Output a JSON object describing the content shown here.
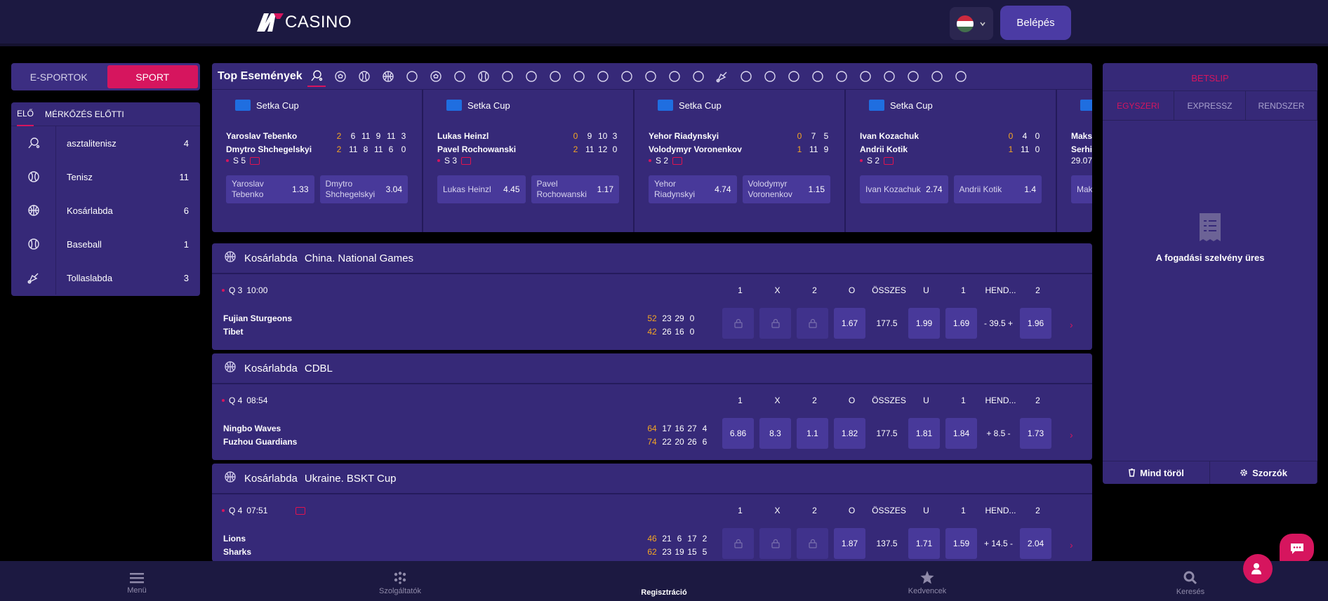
{
  "header": {
    "logo_text": "CASINO",
    "login_label": "Belépés"
  },
  "left": {
    "tabs": [
      "E-SPORTOK",
      "SPORT"
    ],
    "subtabs": [
      "ELŐ",
      "MÉRKŐZÉS ELŐTTI"
    ],
    "sports": [
      {
        "name": "asztalitenisz",
        "count": "4",
        "icon": "table-tennis-icon"
      },
      {
        "name": "Tenisz",
        "count": "11",
        "icon": "tennis-icon"
      },
      {
        "name": "Kosárlabda",
        "count": "6",
        "icon": "basketball-icon"
      },
      {
        "name": "Baseball",
        "count": "1",
        "icon": "baseball-icon"
      },
      {
        "name": "Tollaslabda",
        "count": "3",
        "icon": "badminton-icon"
      }
    ]
  },
  "top_events": {
    "title": "Top Események",
    "cards": [
      {
        "league": "Setka Cup",
        "p1": "Yaroslav Tebenko",
        "p2": "Dmytro Shchegelskyi",
        "s1": "2",
        "s2": "2",
        "sets1": [
          "6",
          "11",
          "9",
          "11",
          "3"
        ],
        "sets2": [
          "11",
          "8",
          "11",
          "6",
          "0"
        ],
        "set": "S 5",
        "o1n": "Yaroslav Tebenko",
        "o1": "1.33",
        "o2n": "Dmytro Shchegelskyi",
        "o2": "3.04"
      },
      {
        "league": "Setka Cup",
        "p1": "Lukas Heinzl",
        "p2": "Pavel Rochowanski",
        "s1": "0",
        "s2": "2",
        "sets1": [
          "9",
          "10",
          "3"
        ],
        "sets2": [
          "11",
          "12",
          "0"
        ],
        "set": "S 3",
        "o1n": "Lukas Heinzl",
        "o1": "4.45",
        "o2n": "Pavel Rochowanski",
        "o2": "1.17"
      },
      {
        "league": "Setka Cup",
        "p1": "Yehor Riadynskyi",
        "p2": "Volodymyr Voronenkov",
        "s1": "0",
        "s2": "1",
        "sets1": [
          "7",
          "5"
        ],
        "sets2": [
          "11",
          "9"
        ],
        "set": "S 2",
        "o1n": "Yehor Riadynskyi",
        "o1": "4.74",
        "o2n": "Volodymyr Voronenkov",
        "o2": "1.15"
      },
      {
        "league": "Setka Cup",
        "p1": "Ivan Kozachuk",
        "p2": "Andrii Kotik",
        "s1": "0",
        "s2": "1",
        "sets1": [
          "4",
          "0"
        ],
        "sets2": [
          "11",
          "0"
        ],
        "set": "S 2",
        "o1n": "Ivan Kozachuk",
        "o1": "2.74",
        "o2n": "Andrii Kotik",
        "o2": "1.4"
      }
    ],
    "partial": {
      "p1": "Maks",
      "p2": "Serhi",
      "date": "29.07",
      "odd": "Mak"
    }
  },
  "columns": [
    "1",
    "X",
    "2",
    "O",
    "ÖSSZES",
    "U",
    "1",
    "HEND...",
    "2"
  ],
  "matches": [
    {
      "sport": "Kosárlabda",
      "league": "China. National Games",
      "period": "Q 3",
      "time": "10:00",
      "tv": false,
      "t1": "Fujian Sturgeons",
      "t2": "Tibet",
      "p1": "52",
      "p2": "42",
      "q1": [
        "23",
        "29",
        "0"
      ],
      "q2": [
        "26",
        "16",
        "0"
      ],
      "odds": [
        "",
        "",
        "",
        "1.67",
        "177.5",
        "1.99",
        "1.69",
        "- 39.5 +",
        "1.96"
      ],
      "locked": true
    },
    {
      "sport": "Kosárlabda",
      "league": "CDBL",
      "period": "Q 4",
      "time": "08:54",
      "tv": false,
      "t1": "Ningbo Waves",
      "t2": "Fuzhou Guardians",
      "p1": "64",
      "p2": "74",
      "q1": [
        "17",
        "16",
        "27",
        "4"
      ],
      "q2": [
        "22",
        "20",
        "26",
        "6"
      ],
      "odds": [
        "6.86",
        "8.3",
        "1.1",
        "1.82",
        "177.5",
        "1.81",
        "1.84",
        "+ 8.5 -",
        "1.73"
      ],
      "locked": false
    },
    {
      "sport": "Kosárlabda",
      "league": "Ukraine. BSKT Cup",
      "period": "Q 4",
      "time": "07:51",
      "tv": true,
      "t1": "Lions",
      "t2": "Sharks",
      "p1": "46",
      "p2": "62",
      "q1": [
        "21",
        "6",
        "17",
        "2"
      ],
      "q2": [
        "23",
        "19",
        "15",
        "5"
      ],
      "odds": [
        "",
        "",
        "",
        "1.87",
        "137.5",
        "1.71",
        "1.59",
        "+ 14.5 -",
        "2.04"
      ],
      "locked": true
    }
  ],
  "betslip": {
    "title": "BETSLIP",
    "tabs": [
      "EGYSZERI",
      "EXPRESSZ",
      "RENDSZER"
    ],
    "empty": "A fogadási szelvény üres",
    "clear": "Mind töröl",
    "odds": "Szorzók"
  },
  "bottom_nav": [
    "Menü",
    "Szolgáltatók",
    "Regisztráció",
    "Kedvencek",
    "Keresés"
  ],
  "colors": {
    "accent": "#d6155e",
    "panel": "#362978",
    "header": "#1c1941",
    "score": "#f5a623"
  }
}
